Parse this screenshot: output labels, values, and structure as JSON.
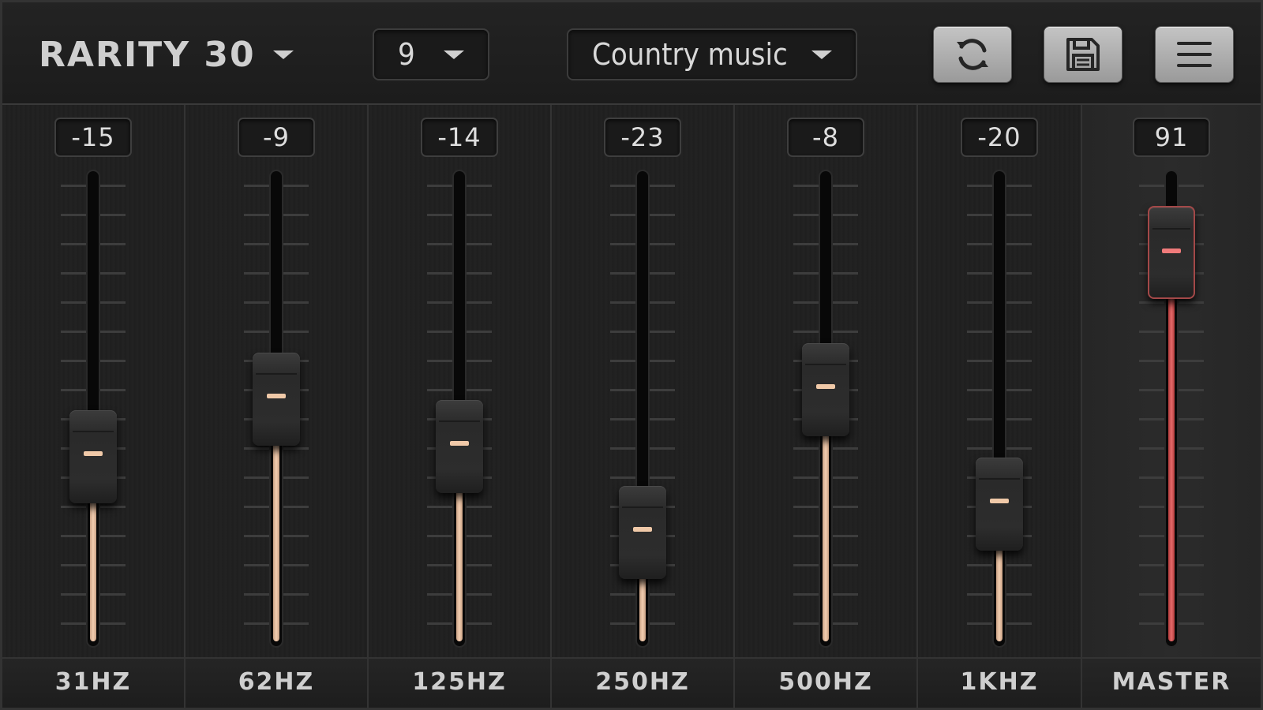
{
  "header": {
    "preset_bank": "RARITY 30",
    "band_count": "9",
    "preset_name": "Country music",
    "buttons": [
      {
        "name": "refresh-button",
        "icon": "refresh-icon"
      },
      {
        "name": "save-button",
        "icon": "save-icon"
      },
      {
        "name": "menu-button",
        "icon": "hamburger-menu-icon"
      }
    ]
  },
  "slider_range": {
    "min": -30,
    "max": 10
  },
  "master_range": {
    "min": 0,
    "max": 100
  },
  "colors": {
    "band_fill": "#f2cdb0",
    "master_fill": "#e46a6a",
    "handle_grip": "#f0c9a8",
    "master_grip": "#f07b7b"
  },
  "channels": [
    {
      "id": "31hz",
      "label": "31HZ",
      "value": "-15"
    },
    {
      "id": "62hz",
      "label": "62HZ",
      "value": "-9"
    },
    {
      "id": "125hz",
      "label": "125HZ",
      "value": "-14"
    },
    {
      "id": "250hz",
      "label": "250HZ",
      "value": "-23"
    },
    {
      "id": "500hz",
      "label": "500HZ",
      "value": "-8"
    },
    {
      "id": "1khz",
      "label": "1KHZ",
      "value": "-20"
    },
    {
      "id": "master",
      "label": "MASTER",
      "value": "91",
      "master": true
    }
  ]
}
